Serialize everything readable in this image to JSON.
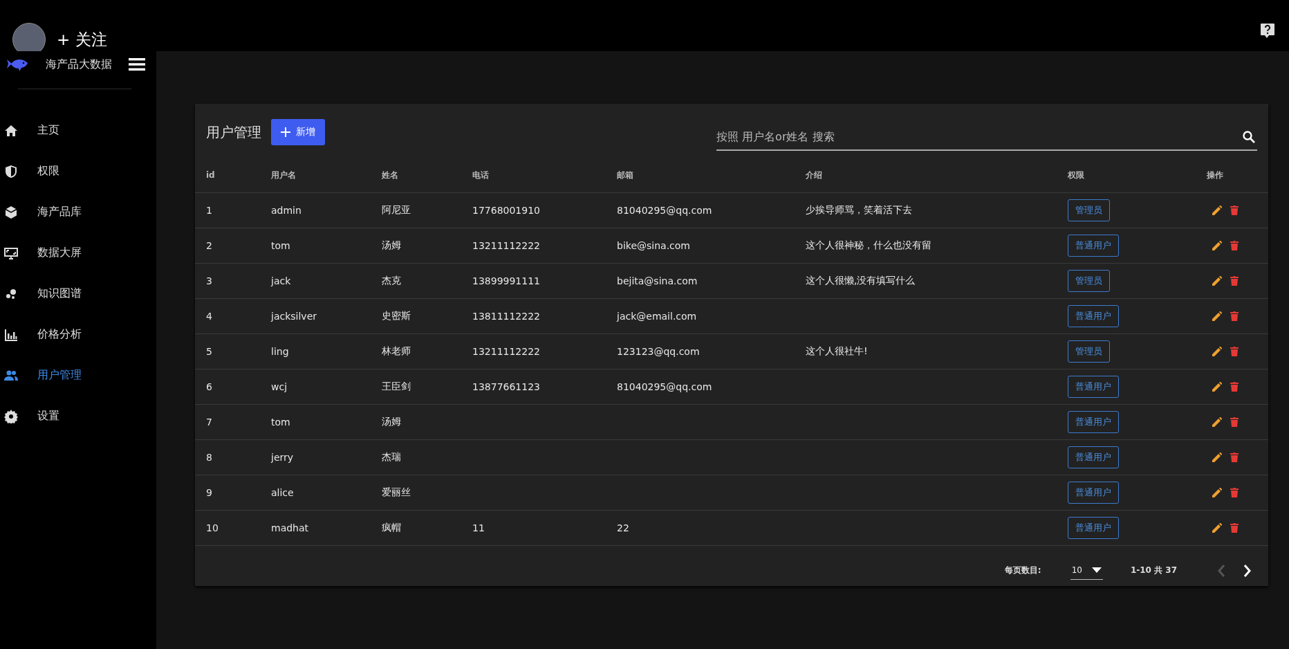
{
  "top_bar": {
    "follow_label": "+ 关注"
  },
  "sidebar": {
    "brand": "海产品大数据",
    "items": [
      {
        "label": "主页",
        "selected": false
      },
      {
        "label": "权限",
        "selected": false
      },
      {
        "label": "海产品库",
        "selected": false
      },
      {
        "label": "数据大屏",
        "selected": false
      },
      {
        "label": "知识图谱",
        "selected": false
      },
      {
        "label": "价格分析",
        "selected": false
      },
      {
        "label": "用户管理",
        "selected": true
      },
      {
        "label": "设置",
        "selected": false
      }
    ]
  },
  "card": {
    "title": "用户管理",
    "add_button": "新增",
    "search": {
      "placeholder": "按照 用户名or姓名 搜索"
    }
  },
  "table": {
    "columns": [
      "id",
      "用户名",
      "姓名",
      "电话",
      "邮箱",
      "介绍",
      "权限",
      "操作"
    ],
    "rows": [
      {
        "id": "1",
        "username": "admin",
        "name": "阿尼亚",
        "phone": "17768001910",
        "email": "81040295@qq.com",
        "intro": "少挨导师骂，笑着活下去",
        "role": "管理员"
      },
      {
        "id": "2",
        "username": "tom",
        "name": "汤姆",
        "phone": "13211112222",
        "email": "bike@sina.com",
        "intro": "这个人很神秘，什么也没有留",
        "role": "普通用户"
      },
      {
        "id": "3",
        "username": "jack",
        "name": "杰克",
        "phone": "13899991111",
        "email": "bejita@sina.com",
        "intro": "这个人很懒,没有填写什么",
        "role": "管理员"
      },
      {
        "id": "4",
        "username": "jacksilver",
        "name": "史密斯",
        "phone": "13811112222",
        "email": "jack@email.com",
        "role": "普通用户"
      },
      {
        "id": "5",
        "username": "ling",
        "name": "林老师",
        "phone": "13211112222",
        "email": "123123@qq.com",
        "intro": "这个人很社牛!",
        "role": "管理员"
      },
      {
        "id": "6",
        "username": "wcj",
        "name": "王臣剑",
        "phone": "13877661123",
        "email": "81040295@qq.com",
        "role": "普通用户"
      },
      {
        "id": "7",
        "username": "tom",
        "name": "汤姆",
        "role": "普通用户"
      },
      {
        "id": "8",
        "username": "jerry",
        "name": "杰瑞",
        "role": "普通用户"
      },
      {
        "id": "9",
        "username": "alice",
        "name": "爱丽丝",
        "role": "普通用户"
      },
      {
        "id": "10",
        "username": "madhat",
        "name": "疯帽",
        "phone": "11",
        "email": "22",
        "role": "普通用户"
      }
    ]
  },
  "pagination": {
    "per_page_label": "每页数目:",
    "per_page": "10",
    "range": "1-10 共 37",
    "prev_disabled": true,
    "next_disabled": false
  }
}
